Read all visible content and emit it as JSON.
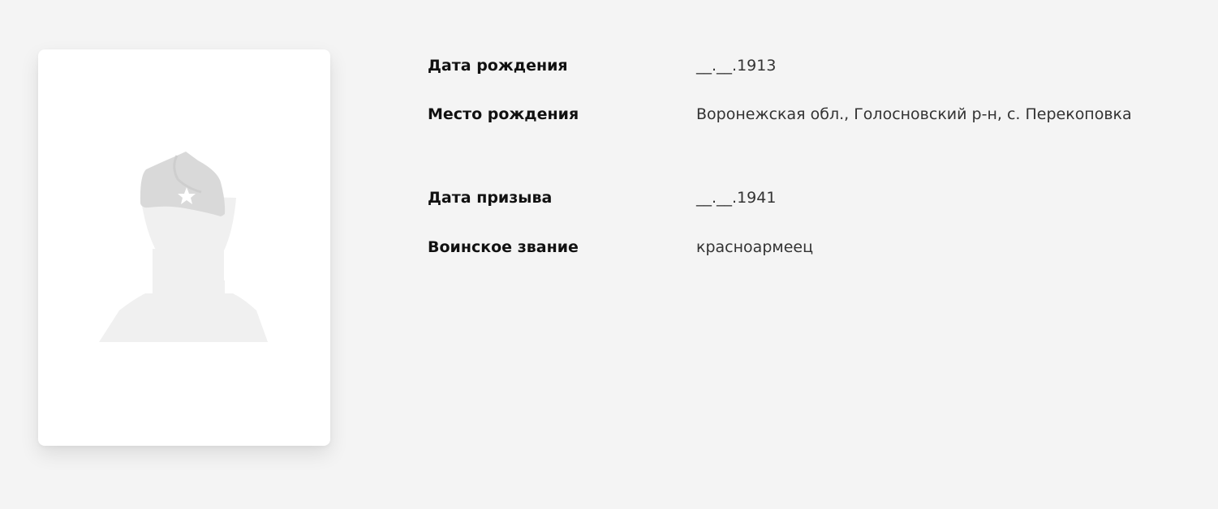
{
  "profile": {
    "photo": {
      "icon": "soldier-silhouette-placeholder"
    },
    "fields": [
      {
        "label": "Дата рождения",
        "value": "__.__.1913"
      },
      {
        "label": "Место рождения",
        "value": "Воронежская обл., Голосновский р-н, с. Перекоповка"
      },
      {
        "label": "Дата призыва",
        "value": "__.__.1941"
      },
      {
        "label": "Воинское звание",
        "value": "красноармеец"
      }
    ]
  },
  "colors": {
    "background": "#f4f4f4",
    "card": "#ffffff",
    "silhouette_body": "#f0f0f0",
    "silhouette_cap": "#d9d9d9",
    "label_text": "#111111",
    "value_text": "#333333"
  }
}
